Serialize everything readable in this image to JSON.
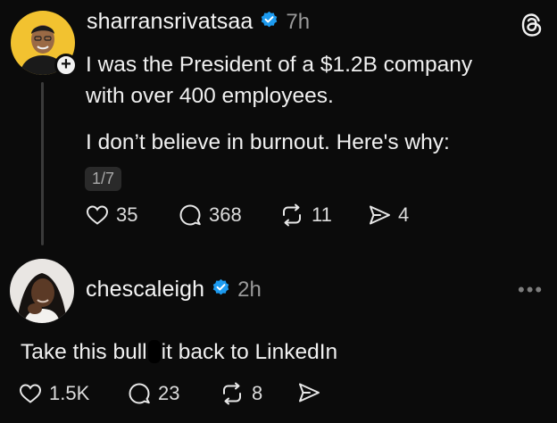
{
  "post": {
    "username": "sharransrivatsaa",
    "time": "7h",
    "text_line1": "I was the President of a $1.2B company",
    "text_line2": "with over 400 employees.",
    "text_line3": "I don’t believe in burnout. Here's why:",
    "page_badge": "1/7",
    "likes": "35",
    "replies": "368",
    "reposts": "11",
    "shares": "4"
  },
  "reply": {
    "username": "chescaleigh",
    "time": "2h",
    "text_before": "Take this bull",
    "text_after": "it back to LinkedIn",
    "likes": "1.5K",
    "replies": "23",
    "reposts": "8"
  },
  "colors": {
    "background": "#0b0b0b",
    "verified": "#1d9bf0",
    "avatar1_bg": "#f2c230"
  },
  "icons": [
    "threads-logo-icon",
    "verified-badge-icon",
    "plus-icon",
    "heart-icon",
    "comment-icon",
    "repost-icon",
    "send-icon",
    "more-icon"
  ]
}
